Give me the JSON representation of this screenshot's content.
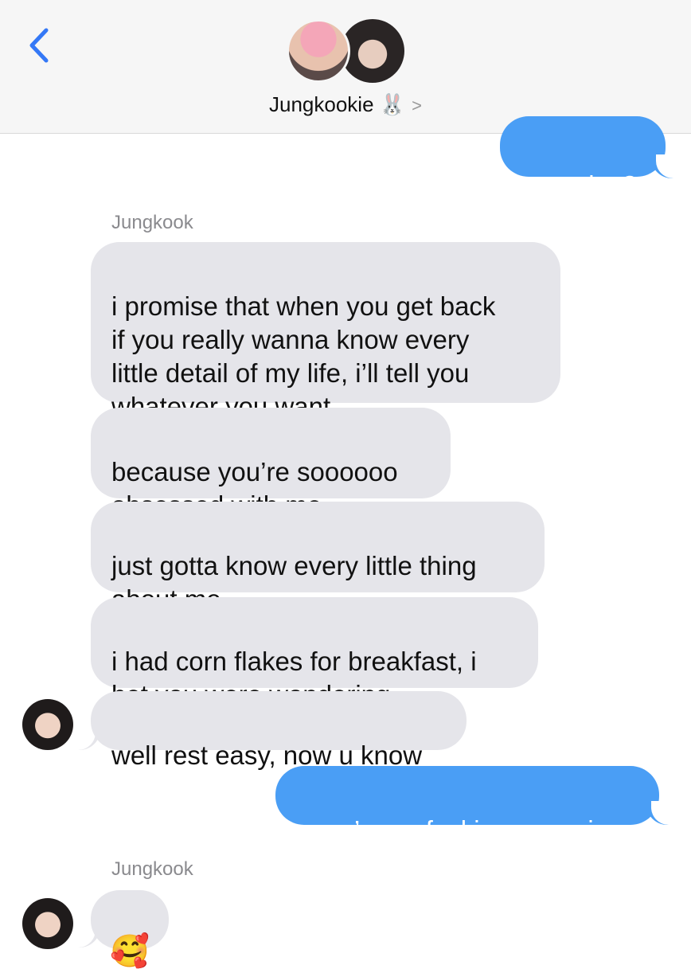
{
  "header": {
    "contact_name": "Jungkookie 🐰",
    "chevron": ">",
    "back_icon": "chevron-left-icon",
    "accent_color": "#3478f6"
  },
  "messages": [
    {
      "dir": "out",
      "text": "promise?"
    },
    {
      "dir": "label",
      "text": "Jungkook"
    },
    {
      "dir": "in",
      "text": "i promise that when you get back\nif you really wanna know every\nlittle detail of my life, i’ll tell you\nwhatever you want"
    },
    {
      "dir": "in",
      "text": "because you’re soooooo\nobsessed with me"
    },
    {
      "dir": "in",
      "text": "just gotta know every little thing\nabout me"
    },
    {
      "dir": "in",
      "text": "i had corn flakes for breakfast, i\nbet you were wondering"
    },
    {
      "dir": "in",
      "text": "well rest easy, now u know"
    },
    {
      "dir": "out",
      "text": "you’re so fucking annoying"
    },
    {
      "dir": "label",
      "text": "Jungkook"
    },
    {
      "dir": "in",
      "text": "🥰"
    }
  ],
  "colors": {
    "incoming_bubble": "#e5e5ea",
    "outgoing_bubble": "#4a9ef5",
    "header_bg": "#f6f6f6"
  }
}
